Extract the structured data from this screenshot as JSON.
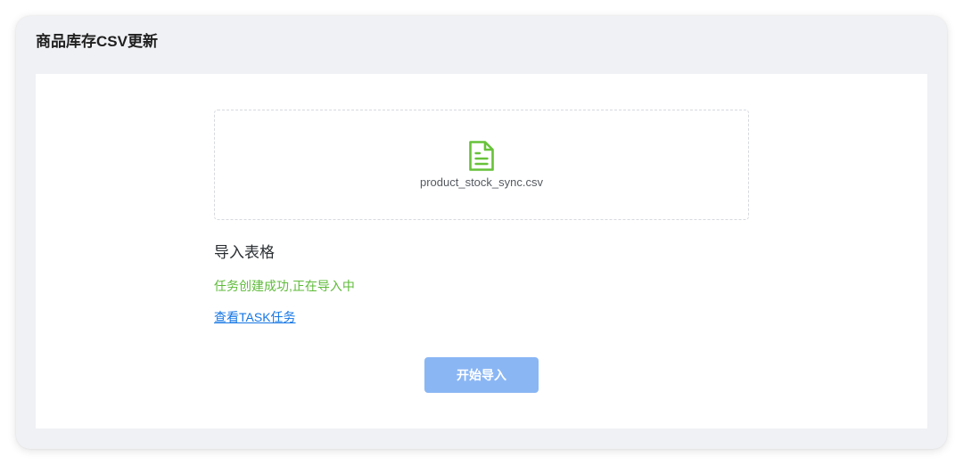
{
  "page": {
    "title": "商品库存CSV更新"
  },
  "upload": {
    "file_name": "product_stock_sync.csv",
    "icon": "file-text-icon"
  },
  "section": {
    "heading": "导入表格",
    "status_message": "任务创建成功,正在导入中",
    "task_link": "查看TASK任务"
  },
  "actions": {
    "start_import_label": "开始导入"
  },
  "colors": {
    "card_background": "#f0f1f4",
    "panel_background": "#ffffff",
    "icon": "#67c23a",
    "success_text": "#5fbb3a",
    "link": "#1677e5",
    "button_background": "#8ab6f4",
    "button_text": "#ffffff"
  }
}
